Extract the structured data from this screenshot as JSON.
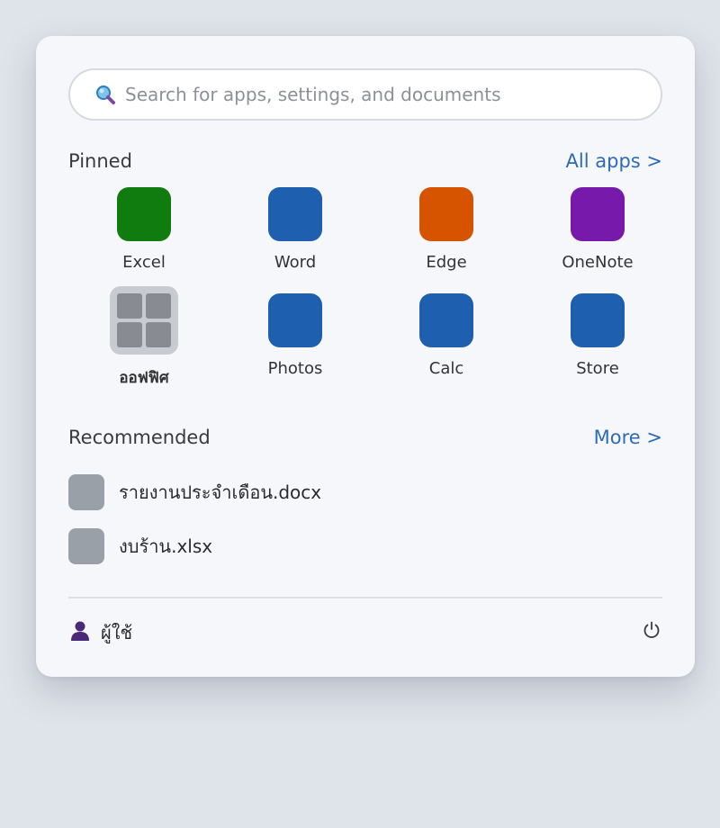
{
  "search": {
    "placeholder": "Search for apps, settings, and documents",
    "icon": "search-icon"
  },
  "pinned": {
    "title": "Pinned",
    "all_apps_label": "All apps >",
    "apps": [
      {
        "label": "Excel",
        "color": "#107c10"
      },
      {
        "label": "Word",
        "color": "#1e5fb0"
      },
      {
        "label": "Edge",
        "color": "#d65300"
      },
      {
        "label": "OneNote",
        "color": "#7719aa"
      },
      {
        "label": "ออฟฟิศ",
        "color": "#c8cbd1",
        "icon": "app-grid-icon"
      },
      {
        "label": "Photos",
        "color": "#1e5fb0"
      },
      {
        "label": "Calc",
        "color": "#1e5fb0"
      },
      {
        "label": "Store",
        "color": "#1e5fb0"
      }
    ]
  },
  "recommended": {
    "title": "Recommended",
    "more_label": "More >",
    "items": [
      {
        "name": "รายงานประจำเดือน.docx"
      },
      {
        "name": "งบร้าน.xlsx"
      }
    ]
  },
  "footer": {
    "user_name": "ผู้ใช้",
    "user_icon": "user-icon",
    "power_icon": "power-icon"
  }
}
